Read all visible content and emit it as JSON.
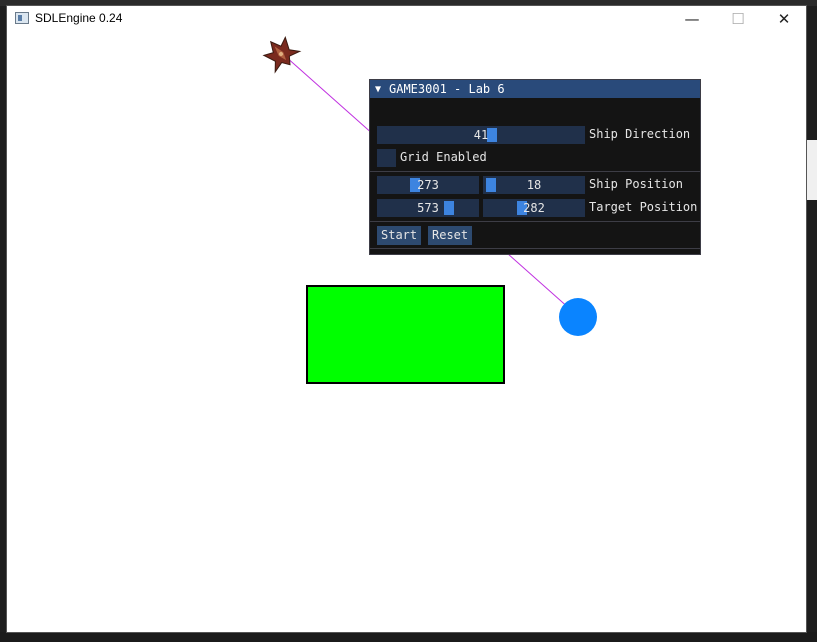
{
  "window": {
    "title": "SDLEngine 0.24",
    "minimize_glyph": "—",
    "maximize_glyph": "☐",
    "close_glyph": "✕"
  },
  "panel": {
    "title": "GAME3001 - Lab 6",
    "collapse_glyph": "▼",
    "ship_direction": {
      "value": "41",
      "label": "Ship Direction"
    },
    "grid": {
      "label": "Grid Enabled",
      "checked": false
    },
    "ship_position": {
      "x": "273",
      "y": "18",
      "label": "Ship Position"
    },
    "target_position": {
      "x": "573",
      "y": "282",
      "label": "Target Position"
    },
    "buttons": {
      "start": "Start",
      "reset": "Reset"
    }
  },
  "scene": {
    "obstacle_color": "#00ff00",
    "target_color": "#0a84ff",
    "line_color": "#c030e0"
  }
}
